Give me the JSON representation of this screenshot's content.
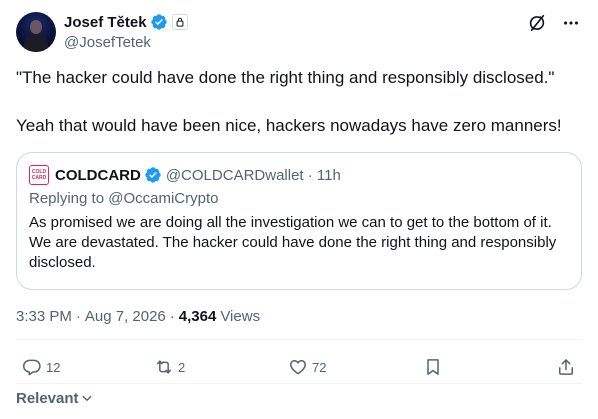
{
  "author": {
    "display_name": "Josef Tětek",
    "handle": "@JosefTetek"
  },
  "tweet": {
    "paragraphs": [
      "\"The hacker could have done the right thing and responsibly disclosed.\"",
      "Yeah that would have been nice, hackers nowadays have zero manners!"
    ]
  },
  "quote": {
    "logo_text": "COLD CARD",
    "name": "COLDCARD",
    "handle_time": "@COLDCARDwallet · 11h",
    "replying_to": "Replying to @OccamiCrypto",
    "text": "As promised we are doing all the investigation we can to get to the bottom of it. We are devastated. The hacker could have done the right thing and responsibly disclosed."
  },
  "meta": {
    "time": "3:33 PM",
    "dot": "·",
    "date": "Aug 7, 2026",
    "views_count": "4,364",
    "views_label": "Views"
  },
  "counts": {
    "replies": "12",
    "reposts": "2",
    "likes": "72"
  },
  "sort": {
    "label": "Relevant"
  },
  "colors": {
    "text": "#0f1419",
    "secondary": "#536471",
    "verified": "#1d9bf0",
    "border": "#cfd9de",
    "divider": "#eff3f4"
  },
  "icons": {
    "verified": "verified-badge-icon",
    "lock": "lock-icon",
    "grok": "grok-icon",
    "more": "more-icon",
    "reply": "reply-icon",
    "repost": "repost-icon",
    "like": "heart-icon",
    "bookmark": "bookmark-icon",
    "share": "share-icon",
    "chevron": "chevron-down-icon"
  }
}
